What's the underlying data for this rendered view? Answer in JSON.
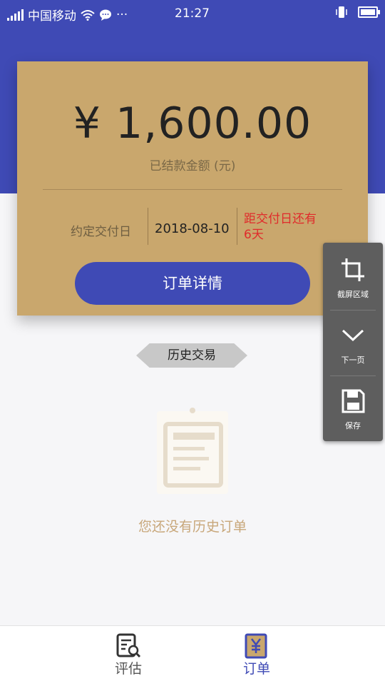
{
  "status_bar": {
    "carrier": "中国移动",
    "more": "···",
    "time": "21:27"
  },
  "card": {
    "amount": "¥ 1,600.00",
    "amount_label": "已结款金额 (元)",
    "due_label": "约定交付日",
    "due_date": "2018-08-10",
    "due_remaining": "距交付日还有6天",
    "order_detail_button": "订单详情"
  },
  "history": {
    "badge_label": "历史交易",
    "empty_text": "您还没有历史订单"
  },
  "side_toolbar": {
    "items": [
      {
        "label": "截屏区域",
        "icon": "crop-icon"
      },
      {
        "label": "下一页",
        "icon": "chevron-down-icon"
      },
      {
        "label": "保存",
        "icon": "save-icon"
      }
    ]
  },
  "bottom_nav": {
    "items": [
      {
        "label": "评估",
        "icon": "evaluate-icon",
        "active": false
      },
      {
        "label": "订单",
        "icon": "order-yen-icon",
        "active": true
      }
    ]
  },
  "colors": {
    "primary": "#3f4ab5",
    "card": "#c9a76d",
    "alert": "#e02b2b",
    "empty_text": "#c8a77a"
  }
}
